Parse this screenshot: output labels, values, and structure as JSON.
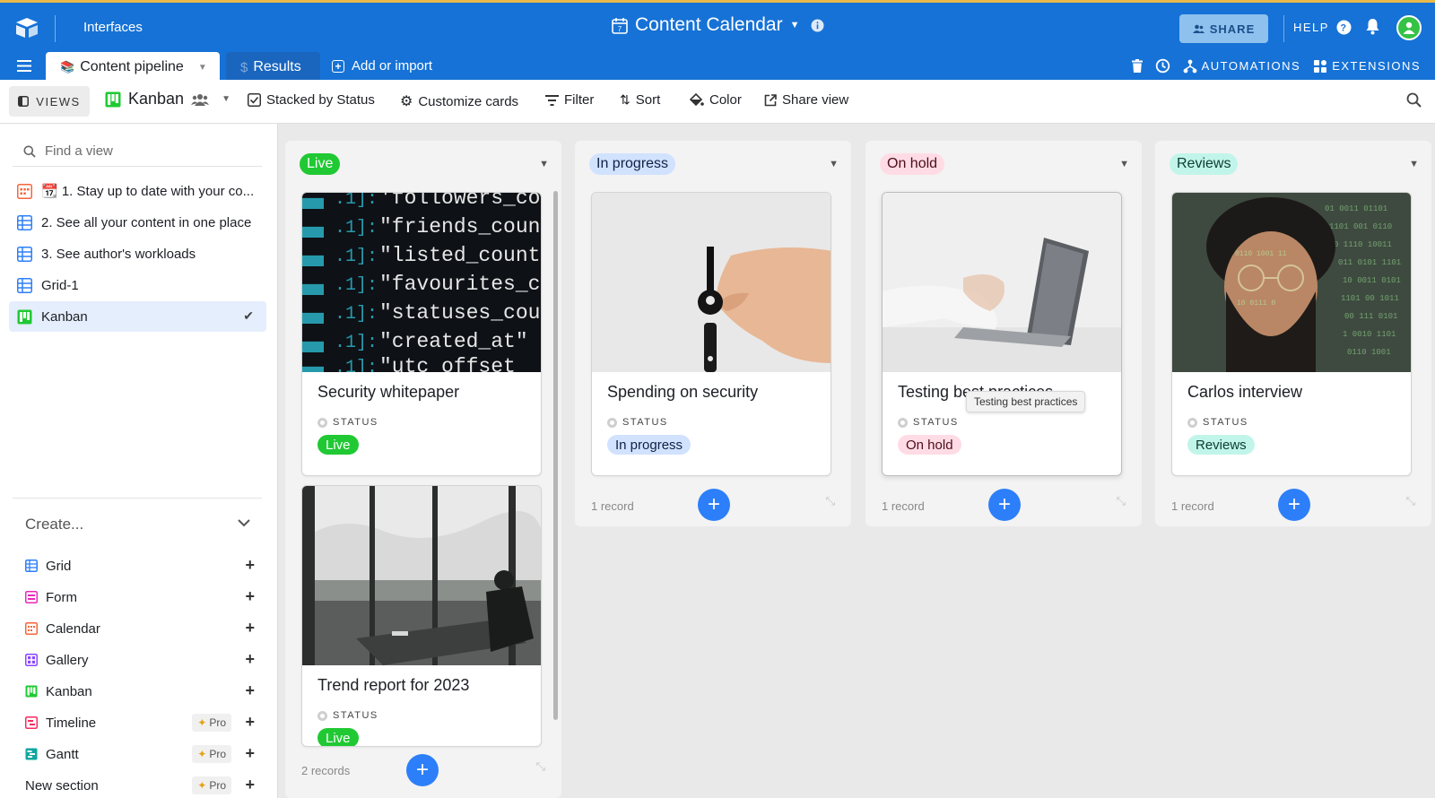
{
  "topbar": {
    "interfaces_label": "Interfaces",
    "base_title": "Content Calendar",
    "share_label": "SHARE",
    "help_label": "HELP",
    "tabs": [
      {
        "label": "Content pipeline",
        "icon": "books-emoji",
        "active": true
      },
      {
        "label": "Results",
        "icon": "dollar-icon",
        "active": false
      }
    ],
    "add_import_label": "Add or import",
    "automations_label": "AUTOMATIONS",
    "extensions_label": "EXTENSIONS",
    "brand_color": "#1672d6"
  },
  "viewbar": {
    "views_label": "VIEWS",
    "current_view": "Kanban",
    "stacked_label": "Stacked by Status",
    "customize_label": "Customize cards",
    "filter_label": "Filter",
    "sort_label": "Sort",
    "color_label": "Color",
    "share_view_label": "Share view"
  },
  "sidebar": {
    "find_placeholder": "Find a view",
    "views": [
      {
        "label": "📆 1. Stay up to date with your co...",
        "icon": "calendar-icon"
      },
      {
        "label": "2. See all your content in one place",
        "icon": "grid-icon"
      },
      {
        "label": "3. See author's workloads",
        "icon": "grid-icon"
      },
      {
        "label": "Grid-1",
        "icon": "grid-icon"
      },
      {
        "label": "Kanban",
        "icon": "kanban-icon",
        "selected": true
      }
    ],
    "create_label": "Create...",
    "create_items": [
      {
        "label": "Grid",
        "icon": "grid-icon",
        "color": "#2d7ff9"
      },
      {
        "label": "Form",
        "icon": "form-icon",
        "color": "#e929ba"
      },
      {
        "label": "Calendar",
        "icon": "calendar-icon",
        "color": "#f7653b"
      },
      {
        "label": "Gallery",
        "icon": "gallery-icon",
        "color": "#8b46ff"
      },
      {
        "label": "Kanban",
        "icon": "kanban-icon",
        "color": "#20c933"
      },
      {
        "label": "Timeline",
        "icon": "timeline-icon",
        "color": "#f82b60",
        "pro": "Pro"
      },
      {
        "label": "Gantt",
        "icon": "gantt-icon",
        "color": "#20d9d2",
        "pro": "Pro"
      },
      {
        "label": "New section",
        "icon": "",
        "pro": "Pro"
      }
    ]
  },
  "board": {
    "status_label": "STATUS",
    "columns": [
      {
        "name": "Live",
        "color": "#20c933",
        "footer": "2 records",
        "cards": [
          {
            "title": "Security whitepaper",
            "status": "Live",
            "image": "code-screen"
          },
          {
            "title": "Trend report for 2023",
            "status": "Live",
            "image": "office-window"
          }
        ]
      },
      {
        "name": "In progress",
        "color": "#d1e2ff",
        "footer": "1 record",
        "cards": [
          {
            "title": "Spending on security",
            "status": "In progress",
            "image": "hand-key"
          }
        ]
      },
      {
        "name": "On hold",
        "color": "#ffdce5",
        "footer": "1 record",
        "cards": [
          {
            "title": "Testing best practices",
            "status": "On hold",
            "image": "laptop-typing"
          }
        ]
      },
      {
        "name": "Reviews",
        "color": "#c2f5e9",
        "footer": "1 record",
        "cards": [
          {
            "title": "Carlos interview",
            "status": "Reviews",
            "image": "man-code-projection"
          }
        ]
      }
    ],
    "tooltip": "Testing best practices"
  }
}
